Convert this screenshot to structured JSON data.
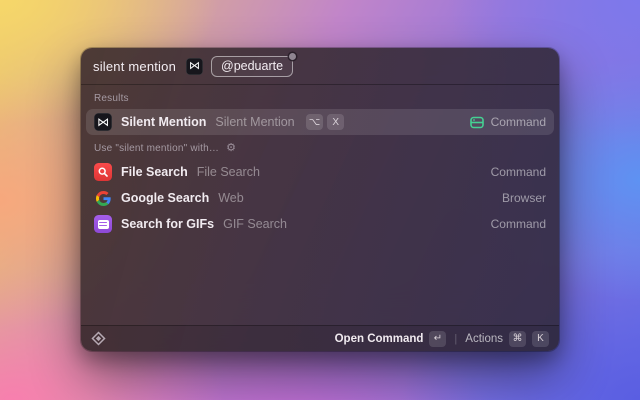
{
  "header": {
    "query": "silent mention",
    "mention": "@peduarte"
  },
  "glyphs": {
    "bowtie": "⋈",
    "gear": "⚙"
  },
  "sections": {
    "results_label": "Results",
    "use_with_label": "Use \"silent mention\" with…"
  },
  "rows": [
    {
      "title": "Silent Mention",
      "subtitle": "Silent Mention",
      "accessory": "Command",
      "keys": [
        "⌥",
        "X"
      ]
    },
    {
      "title": "File Search",
      "subtitle": "File Search",
      "accessory": "Command"
    },
    {
      "title": "Google Search",
      "subtitle": "Web",
      "accessory": "Browser"
    },
    {
      "title": "Search for GIFs",
      "subtitle": "GIF Search",
      "accessory": "Command"
    }
  ],
  "footer": {
    "primary_label": "Open Command",
    "primary_key": "↵",
    "divider": "|",
    "actions_label": "Actions",
    "actions_keys": [
      "⌘",
      "K"
    ]
  },
  "colors": {
    "command_green": "#45d193",
    "file_red": "#fb4b4b",
    "gif_purple": "#a55eea"
  }
}
